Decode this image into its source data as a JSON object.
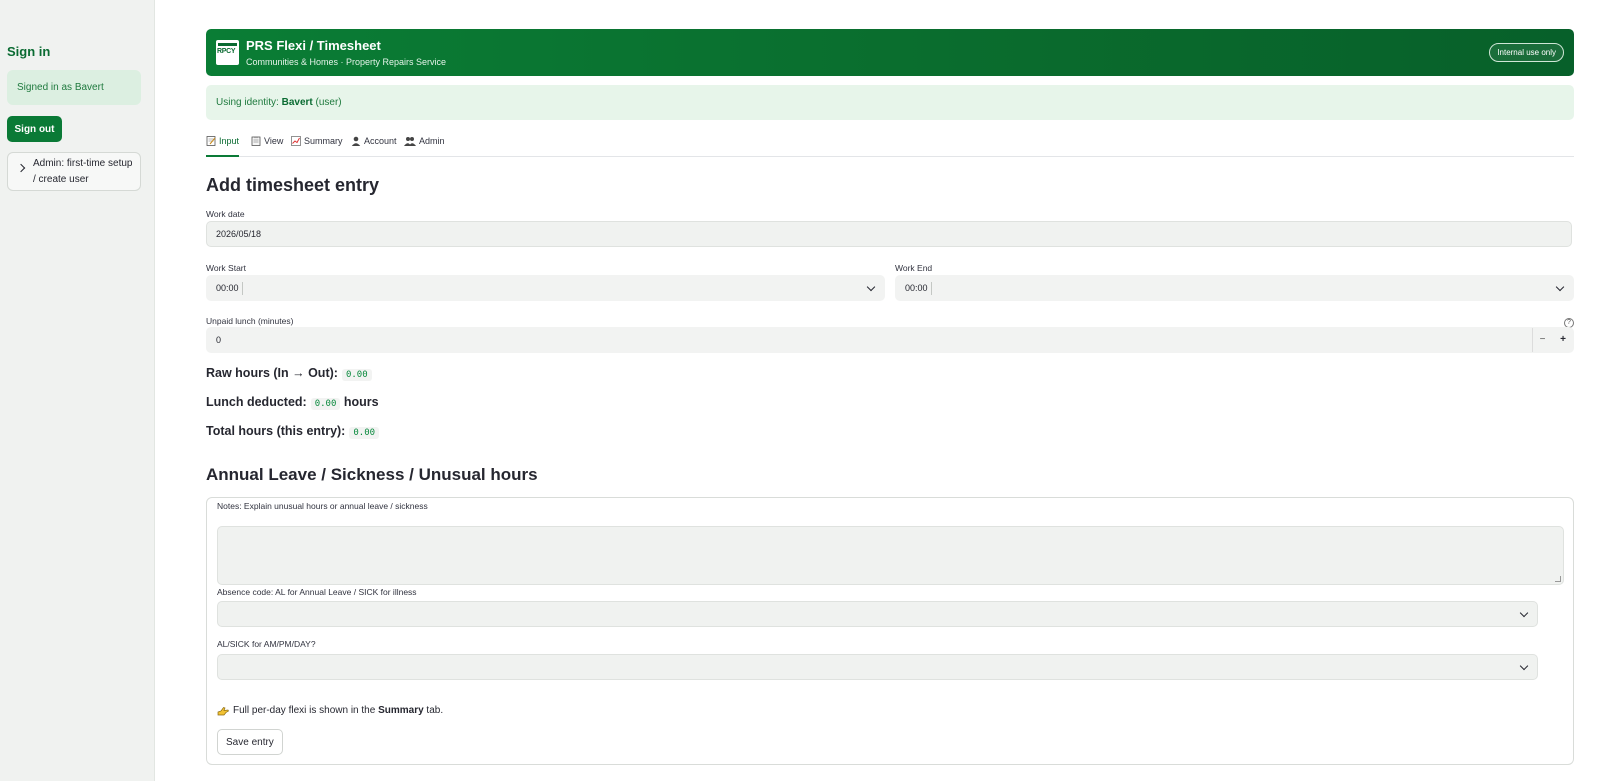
{
  "sidebar": {
    "title": "Sign in",
    "signed_in": "Signed in as Bavert",
    "signout_label": "Sign out",
    "admin_expander": "Admin: first-time setup / create user"
  },
  "banner": {
    "logo_text": "RPCY",
    "title": "PRS Flexi / Timesheet",
    "subtitle": "Communities & Homes · Property Repairs Service",
    "badge": "Internal use only"
  },
  "identity": {
    "prefix": "Using identity: ",
    "name": "Bavert",
    "role": " (user)"
  },
  "tabs": [
    {
      "label": "Input",
      "icon": "memo-icon",
      "active": true
    },
    {
      "label": "View",
      "icon": "clipboard-icon",
      "active": false
    },
    {
      "label": "Summary",
      "icon": "chart-icon",
      "active": false
    },
    {
      "label": "Account",
      "icon": "user-icon",
      "active": false
    },
    {
      "label": "Admin",
      "icon": "users-icon",
      "active": false
    }
  ],
  "form": {
    "heading": "Add timesheet entry",
    "work_date_label": "Work date",
    "work_date_value": "2026/05/18",
    "work_start_label": "Work Start",
    "work_start_value": "00:00",
    "work_end_label": "Work End",
    "work_end_value": "00:00",
    "lunch_label": "Unpaid lunch (minutes)",
    "lunch_value": "0",
    "minus": "−",
    "plus": "+"
  },
  "metrics": {
    "raw_label": "Raw hours (In → Out):",
    "raw_value": "0.00",
    "lunch_label": "Lunch deducted:",
    "lunch_value": "0.00",
    "lunch_unit": "hours",
    "total_label": "Total hours (this entry):",
    "total_value": "0.00"
  },
  "leave": {
    "heading": "Annual Leave / Sickness / Unusual hours",
    "notes_label": "Notes: Explain unusual hours or annual leave / sickness",
    "notes_value": "",
    "absence_label": "Absence code: AL for Annual Leave / SICK for illness",
    "absence_value": "",
    "ampm_label": "AL/SICK for AM/PM/DAY?",
    "ampm_value": "",
    "hint_pre": "Full per-day flexi is shown in the ",
    "hint_bold": "Summary",
    "hint_post": " tab.",
    "save_label": "Save entry"
  },
  "colors": {
    "accent": "#0a7a36",
    "banner": "#0a6b2d",
    "identity_bg": "#e7f5ea"
  }
}
